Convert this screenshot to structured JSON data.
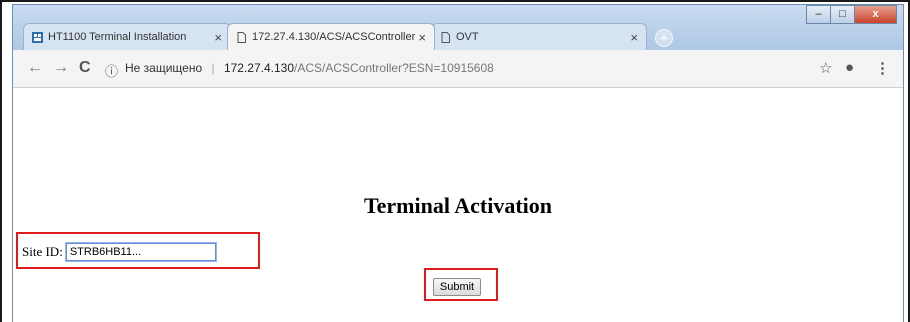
{
  "tabs": [
    {
      "label": "HT1100 Terminal Installation",
      "close": "×"
    },
    {
      "label": "172.27.4.130/ACS/ACSController",
      "close": "×"
    },
    {
      "label": "OVT",
      "close": "×"
    }
  ],
  "new_tab_label": "+",
  "window_controls": {
    "minimize": "–",
    "maximize": "□",
    "close": "x"
  },
  "toolbar": {
    "back": "←",
    "forward": "→",
    "reload": "C",
    "info": "ⓘ",
    "security_text": "Не защищено",
    "separator": "|",
    "url_host": "172.27.4.130",
    "url_path": "/ACS/ACSController?ESN=10915608",
    "star": "☆",
    "profile": "●",
    "menu": "⋮"
  },
  "page": {
    "heading": "Terminal Activation",
    "site_id_label": "Site ID:",
    "site_id_value": "STRB6HB11...",
    "submit_label": "Submit"
  },
  "highlight_color": "#e01b1b"
}
